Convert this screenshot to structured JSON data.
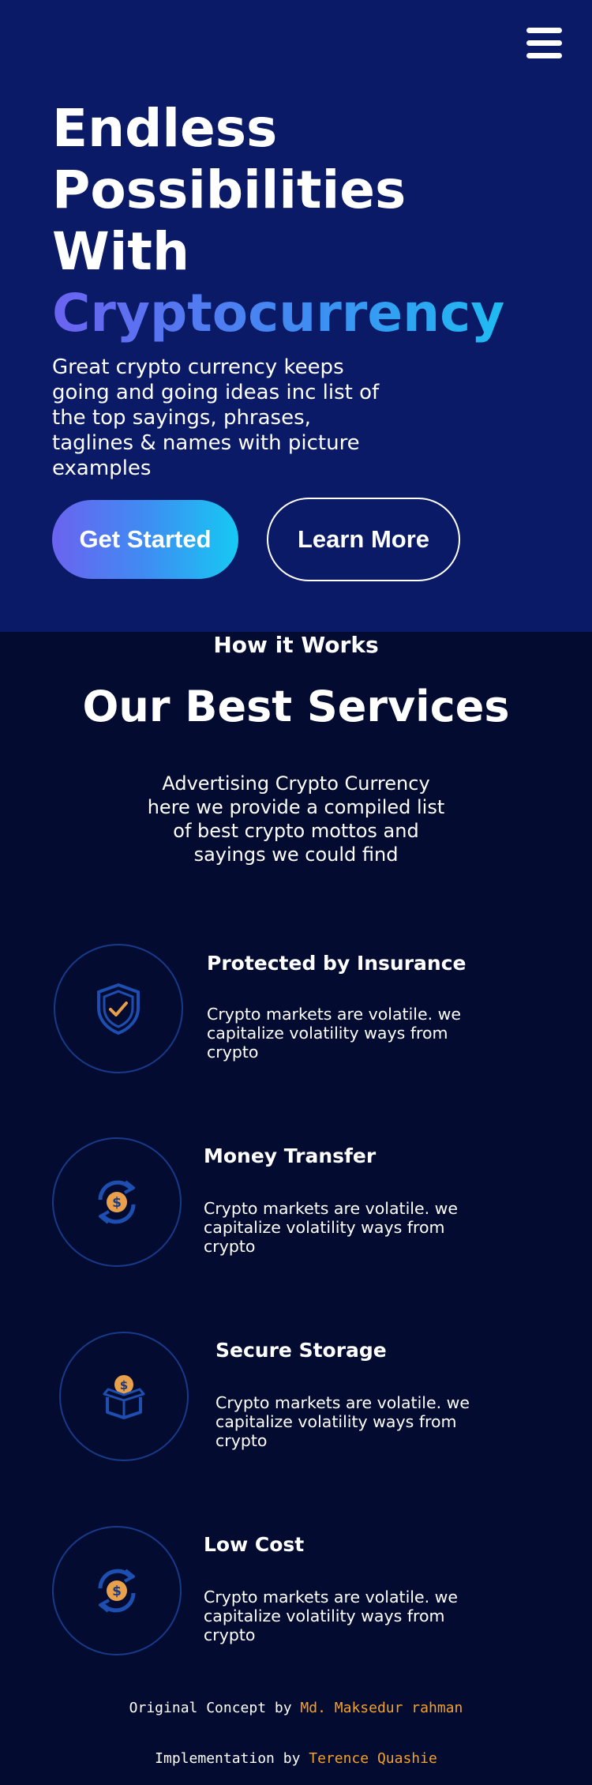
{
  "header": {
    "menu_icon": "hamburger-menu-icon"
  },
  "hero": {
    "title_lines": [
      "Endless",
      "Possibilities",
      "With"
    ],
    "title_accent": "Cryptocurrency",
    "subtitle": "Great crypto currency keeps going and going ideas inc list of the top sayings, phrases, taglines & names with picture examples",
    "primary_button": "Get Started",
    "secondary_button": "Learn More"
  },
  "services": {
    "eyebrow": "How it Works",
    "title": "Our Best Services",
    "description": "Advertising Crypto Currency here we provide a compiled list of best crypto mottos and sayings we could find",
    "items": [
      {
        "icon": "shield-check-icon",
        "title": "Protected by Insurance",
        "text": "Crypto markets are volatile. we capitalize volatility ways from crypto"
      },
      {
        "icon": "money-transfer-icon",
        "title": "Money Transfer",
        "text": "Crypto markets are volatile. we capitalize volatility ways from crypto"
      },
      {
        "icon": "coin-box-icon",
        "title": "Secure Storage",
        "text": "Crypto markets are volatile. we capitalize volatility ways from crypto"
      },
      {
        "icon": "money-transfer-icon",
        "title": "Low Cost",
        "text": "Crypto markets are volatile. we capitalize volatility ways from crypto"
      }
    ]
  },
  "footer": {
    "concept_label": "Original Concept by",
    "concept_name": "Md. Maksedur rahman",
    "impl_label": "Implementation by",
    "impl_name": "Terence Quashie"
  },
  "colors": {
    "hero_bg": "#0a1a66",
    "page_bg": "#040b30",
    "gradient_start": "#6b63f0",
    "gradient_end": "#16c9f3",
    "icon_blue": "#1d4fb0",
    "icon_gold": "#e8a04a",
    "credit_accent": "#f4a12a"
  }
}
